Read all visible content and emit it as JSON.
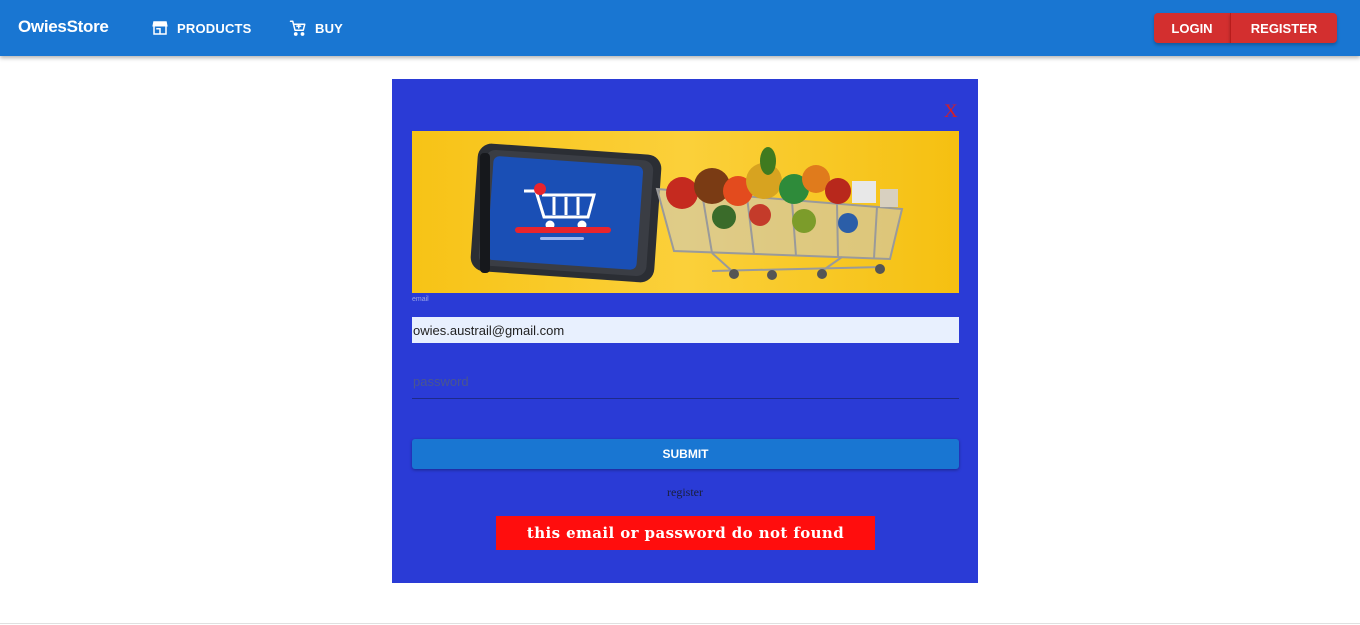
{
  "header": {
    "brand": "OwiesStore",
    "nav": [
      {
        "label": "PRODUCTS",
        "icon": "store-icon"
      },
      {
        "label": "BUY",
        "icon": "cart-icon"
      }
    ],
    "auth": {
      "login_label": "LOGIN",
      "register_label": "REGISTER"
    },
    "colors": {
      "appbar": "#1976d2",
      "auth_buttons": "#d32f2f"
    }
  },
  "login_panel": {
    "close_label": "X",
    "hero_image": "phone-shopping-cart-with-groceries",
    "email_label": "email",
    "email_value": "owies.austrail@gmail.com",
    "password_placeholder": "password",
    "submit_label": "SUBMIT",
    "register_link": "register",
    "error_message": "this email or password do not found",
    "colors": {
      "panel": "#2a3bd6",
      "error": "#ff0d0d",
      "submit": "#1976d2"
    }
  }
}
